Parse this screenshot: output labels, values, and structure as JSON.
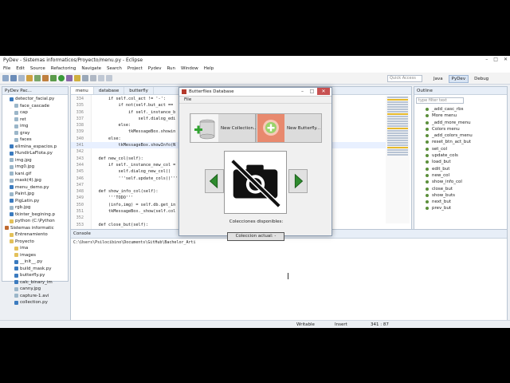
{
  "window": {
    "title": "PyDev - Sistemas informaticos/Proyecto/menu.py - Eclipse",
    "minimize": "–",
    "maximize": "□",
    "close": "✕"
  },
  "menu": [
    "File",
    "Edit",
    "Source",
    "Refactoring",
    "Navigate",
    "Search",
    "Project",
    "Pydev",
    "Run",
    "Window",
    "Help"
  ],
  "toolbar": {
    "quick_access": "Quick Access",
    "perspectives": [
      "Java",
      "PyDev",
      "Debug"
    ]
  },
  "left_panel": {
    "title": "PyDev Pac...",
    "items": [
      {
        "label": "detector_facial.py",
        "type": "py",
        "indent": 1
      },
      {
        "label": "face_cascade",
        "type": "img",
        "indent": 2
      },
      {
        "label": "cap",
        "type": "img",
        "indent": 2
      },
      {
        "label": "ret",
        "type": "img",
        "indent": 2
      },
      {
        "label": "img",
        "type": "img",
        "indent": 2
      },
      {
        "label": "gray",
        "type": "img",
        "indent": 2
      },
      {
        "label": "faces",
        "type": "img",
        "indent": 2
      },
      {
        "label": "elimina_espacios.p",
        "type": "py",
        "indent": 1
      },
      {
        "label": "HundirLaFlota.py",
        "type": "py",
        "indent": 1
      },
      {
        "label": "img.jpg",
        "type": "img",
        "indent": 1
      },
      {
        "label": "img0.jpg",
        "type": "img",
        "indent": 1
      },
      {
        "label": "kani.gif",
        "type": "img",
        "indent": 1
      },
      {
        "label": "mask(4).jpg",
        "type": "img",
        "indent": 1
      },
      {
        "label": "menu_demo.py",
        "type": "py",
        "indent": 1
      },
      {
        "label": "Paint.jpg",
        "type": "img",
        "indent": 1
      },
      {
        "label": "PigLatin.py",
        "type": "py",
        "indent": 1
      },
      {
        "label": "rgb.jpg",
        "type": "img",
        "indent": 1
      },
      {
        "label": "tkinter_begining.p",
        "type": "py",
        "indent": 1
      },
      {
        "label": "python  (C:\\Python",
        "type": "fld",
        "indent": 1
      },
      {
        "label": "Sistemas informatic",
        "type": "proj",
        "indent": 0
      },
      {
        "label": "Entrenamiento",
        "type": "fld",
        "indent": 1
      },
      {
        "label": "Proyecto",
        "type": "fld",
        "indent": 1
      },
      {
        "label": "ima",
        "type": "fld",
        "indent": 2
      },
      {
        "label": "images",
        "type": "fld",
        "indent": 2
      },
      {
        "label": "__init__.py",
        "type": "py",
        "indent": 2
      },
      {
        "label": "build_mask.py",
        "type": "py",
        "indent": 2
      },
      {
        "label": "butterfly.py",
        "type": "py",
        "indent": 2
      },
      {
        "label": "calc_binary_im",
        "type": "py",
        "indent": 2
      },
      {
        "label": "canny.jpg",
        "type": "img",
        "indent": 2
      },
      {
        "label": "capture-1.avi",
        "type": "img",
        "indent": 2
      },
      {
        "label": "collection.py",
        "type": "py",
        "indent": 2
      }
    ]
  },
  "editor": {
    "tabs": [
      "menu",
      "database",
      "butterfly",
      "",
      "",
      "",
      "resize"
    ],
    "lines": [
      {
        "n": "334",
        "t": "        if self.col_act != '-':",
        "hl": false
      },
      {
        "n": "335",
        "t": "            if not(self.but_act == ",
        "hl": false
      },
      {
        "n": "336",
        "t": "                if self._instance_b",
        "hl": false
      },
      {
        "n": "337",
        "t": "                    self.dialog_edi",
        "hl": false
      },
      {
        "n": "338",
        "t": "            else:",
        "hl": false
      },
      {
        "n": "339",
        "t": "                tkMessageBox.showin",
        "hl": false
      },
      {
        "n": "340",
        "t": "        else:",
        "hl": false
      },
      {
        "n": "341",
        "t": "            tkMessageBox.showInfo(N",
        "hl": true
      },
      {
        "n": "342",
        "t": "",
        "hl": false
      },
      {
        "n": "343",
        "t": "    def new_col(self):",
        "hl": false
      },
      {
        "n": "344",
        "t": "        if self._instance_new_col =",
        "hl": false
      },
      {
        "n": "345",
        "t": "            self.dialog_new_col()",
        "hl": false
      },
      {
        "n": "346",
        "t": "            '''self.update_cols()'''",
        "hl": false
      },
      {
        "n": "347",
        "t": "",
        "hl": false
      },
      {
        "n": "348",
        "t": "    def show_info_col(self):",
        "hl": false
      },
      {
        "n": "349",
        "t": "        '''TODO'''",
        "hl": false
      },
      {
        "n": "350",
        "t": "        (info,img) = self.db.get_in",
        "hl": false
      },
      {
        "n": "351",
        "t": "        tkMessageBox._show(self.col",
        "hl": false
      },
      {
        "n": "352",
        "t": "",
        "hl": false
      },
      {
        "n": "353",
        "t": "    def close_but(self):",
        "hl": false
      },
      {
        "n": "354",
        "t": "        if self.panel != Null:",
        "hl": false
      },
      {
        "n": "355",
        "t": "            self.panel.destroy()",
        "hl": false
      },
      {
        "n": "356",
        "t": "",
        "hl": false
      }
    ]
  },
  "outline": {
    "title": "Outline",
    "filter_placeholder": "type filter text",
    "items": [
      "_add_casc_rbs",
      "More menu",
      "_add_more_menu",
      "Colors menu",
      "_add_colors_menu",
      "reset_btn_act_but",
      "set_col",
      "update_cols",
      "load_but",
      "edit_but",
      "new_col",
      "show_info_col",
      "close_but",
      "show_buts",
      "next_but",
      "prev_but"
    ]
  },
  "console": {
    "title": "Console",
    "path": "C:\\Users\\Psilocibino\\Documents\\GitHub\\Bachelor_Arti"
  },
  "statusbar": {
    "mode": "Writable",
    "insert": "Insert",
    "position": "341 : 87"
  },
  "dialog": {
    "title": "Butterflies Database",
    "menu": "File",
    "new_collection": "New Collection...",
    "new_butterfly": "New Butterfly...",
    "collections_label": "Colecciones disponibles:",
    "actual_button": "Coleccion actual: -"
  },
  "colors": {
    "accent": "#3b7bbf",
    "arrow_green": "#2e8b2e",
    "close_red": "#c75050"
  }
}
